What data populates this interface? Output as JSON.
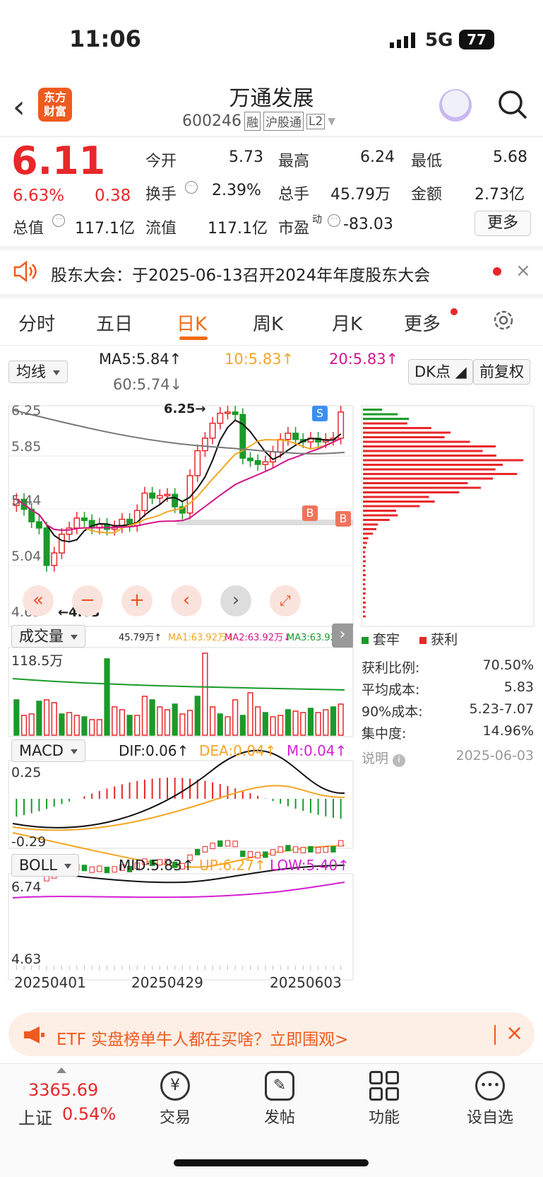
{
  "status": {
    "time": "11:06",
    "network": "5G",
    "battery": "77"
  },
  "header": {
    "brand": "东方\n财富",
    "title": "万通发展",
    "code": "600246",
    "tags": [
      "融",
      "沪股通",
      "L2"
    ]
  },
  "quote": {
    "price": "6.11",
    "pct": "6.63%",
    "chg": "0.38",
    "fields": [
      {
        "label": "今开",
        "value": "5.73"
      },
      {
        "label": "最高",
        "value": "6.24"
      },
      {
        "label": "最低",
        "value": "5.68"
      },
      {
        "label": "换手",
        "value": "2.39%"
      },
      {
        "label": "总手",
        "value": "45.79万"
      },
      {
        "label": "金额",
        "value": "2.73亿"
      },
      {
        "label": "总值",
        "value": "117.1亿"
      },
      {
        "label": "流值",
        "value": "117.1亿"
      },
      {
        "label": "市盈",
        "value": "-83.03"
      }
    ],
    "sup_dong": "动",
    "more_label": "更多"
  },
  "notice": {
    "text": "股东大会：于2025-06-13召开2024年年度股东大会"
  },
  "tabs": [
    "分时",
    "五日",
    "日K",
    "周K",
    "月K",
    "更多"
  ],
  "ma": {
    "btn": "均线",
    "ma5": "MA5:5.84↑",
    "ma10": "10:5.83↑",
    "ma20": "20:5.83↑",
    "ma60": "60:5.74↓",
    "dk": "DK点",
    "fq": "前复权"
  },
  "kline": {
    "yticks": [
      "6.25",
      "5.85",
      "5.44",
      "5.04",
      "4.63"
    ],
    "hi_label": "6.25",
    "lo_label": "←4.63",
    "hi_arrow": "→",
    "s_tag": "S",
    "b_tag": "B"
  },
  "vol": {
    "btn": "成交量",
    "v": "45.79万↑",
    "ma1": "MA1:63.92万↓",
    "ma2": "MA2:63.92万↓",
    "ma3": "MA3:63.92万",
    "ymax": "118.5万"
  },
  "macd": {
    "btn": "MACD",
    "dif": "DIF:0.06↑",
    "dea": "DEA:0.04↑",
    "m": "M:0.04↑",
    "ytop": "0.25",
    "ybot": "-0.29"
  },
  "boll": {
    "btn": "BOLL",
    "mid": "MID:5.83↑",
    "up": "UP:6.27↑",
    "low": "LOW:5.40↑",
    "ytop": "6.74",
    "ybot": "4.63"
  },
  "dates": [
    "20250401",
    "20250429",
    "20250603"
  ],
  "chip": {
    "legend_trap": "套牢",
    "legend_profit": "获利",
    "rows": [
      {
        "label": "获利比例:",
        "value": "70.50%"
      },
      {
        "label": "平均成本:",
        "value": "5.83"
      },
      {
        "label": "90%成本:",
        "value": "5.23-7.07"
      },
      {
        "label": "集中度:",
        "value": "14.96%"
      }
    ],
    "note_label": "说明",
    "note_date": "2025-06-03"
  },
  "banner": {
    "text": "ETF 实盘榜单牛人都在买啥？立即围观>"
  },
  "nav": {
    "index_val": "3365.69",
    "index_name": "上证",
    "index_pct": "0.54%",
    "items": [
      "交易",
      "发帖",
      "功能",
      "设自选"
    ]
  },
  "colors": {
    "up": "#e8272a",
    "down": "#1a9a2a",
    "accent": "#f26a10",
    "ma10": "#f5a623",
    "ma20": "#d4148c"
  }
}
